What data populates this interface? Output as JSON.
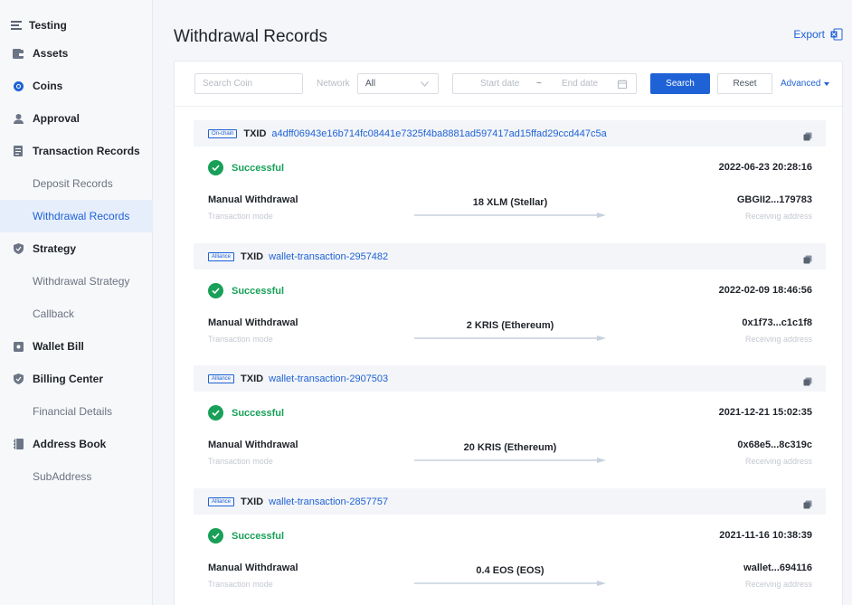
{
  "sidebar": {
    "app_name": "Testing",
    "items": [
      {
        "label": "Assets",
        "type": "main",
        "icon": "wallet-icon"
      },
      {
        "label": "Coins",
        "type": "main",
        "icon": "coin-icon"
      },
      {
        "label": "Approval",
        "type": "main",
        "icon": "user-icon"
      },
      {
        "label": "Transaction Records",
        "type": "main",
        "icon": "document-icon"
      },
      {
        "label": "Deposit Records",
        "type": "sub"
      },
      {
        "label": "Withdrawal Records",
        "type": "sub",
        "active": true
      },
      {
        "label": "Strategy",
        "type": "main",
        "icon": "shield-icon"
      },
      {
        "label": "Withdrawal Strategy",
        "type": "sub"
      },
      {
        "label": "Callback",
        "type": "sub"
      },
      {
        "label": "Wallet Bill",
        "type": "main",
        "icon": "bill-icon"
      },
      {
        "label": "Billing Center",
        "type": "main",
        "icon": "shield-icon"
      },
      {
        "label": "Financial Details",
        "type": "sub"
      },
      {
        "label": "Address Book",
        "type": "main",
        "icon": "book-icon"
      },
      {
        "label": "SubAddress",
        "type": "sub"
      }
    ]
  },
  "header": {
    "title": "Withdrawal Records",
    "export_label": "Export"
  },
  "filters": {
    "search_coin_placeholder": "Search Coin",
    "network_label": "Network",
    "network_value": "All",
    "start_date_placeholder": "Start date",
    "date_separator": "~",
    "end_date_placeholder": "End date",
    "search_button": "Search",
    "reset_button": "Reset",
    "advanced_label": "Advanced"
  },
  "records": [
    {
      "tag": "On-chain",
      "txid_label": "TXID",
      "txid": "a4dff06943e16b714fc08441e7325f4ba8881ad597417ad15ffad29ccd447c5a",
      "status": "Successful",
      "time": "2022-06-23 20:28:16",
      "mode": "Manual Withdrawal",
      "mode_label": "Transaction mode",
      "amount": "18 XLM (Stellar)",
      "address": "GBGII2...179783",
      "address_label": "Receiving address"
    },
    {
      "tag": "Alliance",
      "txid_label": "TXID",
      "txid": "wallet-transaction-2957482",
      "status": "Successful",
      "time": "2022-02-09 18:46:56",
      "mode": "Manual Withdrawal",
      "mode_label": "Transaction mode",
      "amount": "2 KRIS (Ethereum)",
      "address": "0x1f73...c1c1f8",
      "address_label": "Receiving address"
    },
    {
      "tag": "Alliance",
      "txid_label": "TXID",
      "txid": "wallet-transaction-2907503",
      "status": "Successful",
      "time": "2021-12-21 15:02:35",
      "mode": "Manual Withdrawal",
      "mode_label": "Transaction mode",
      "amount": "20 KRIS (Ethereum)",
      "address": "0x68e5...8c319c",
      "address_label": "Receiving address"
    },
    {
      "tag": "Alliance",
      "txid_label": "TXID",
      "txid": "wallet-transaction-2857757",
      "status": "Successful",
      "time": "2021-11-16 10:38:39",
      "mode": "Manual Withdrawal",
      "mode_label": "Transaction mode",
      "amount": "0.4 EOS (EOS)",
      "address": "wallet...694116",
      "address_label": "Receiving address"
    }
  ],
  "colors": {
    "accent": "#1f62d6",
    "success": "#18a058",
    "sidebar_bg": "#f7f8fa",
    "active_bg": "#e6eefb"
  }
}
